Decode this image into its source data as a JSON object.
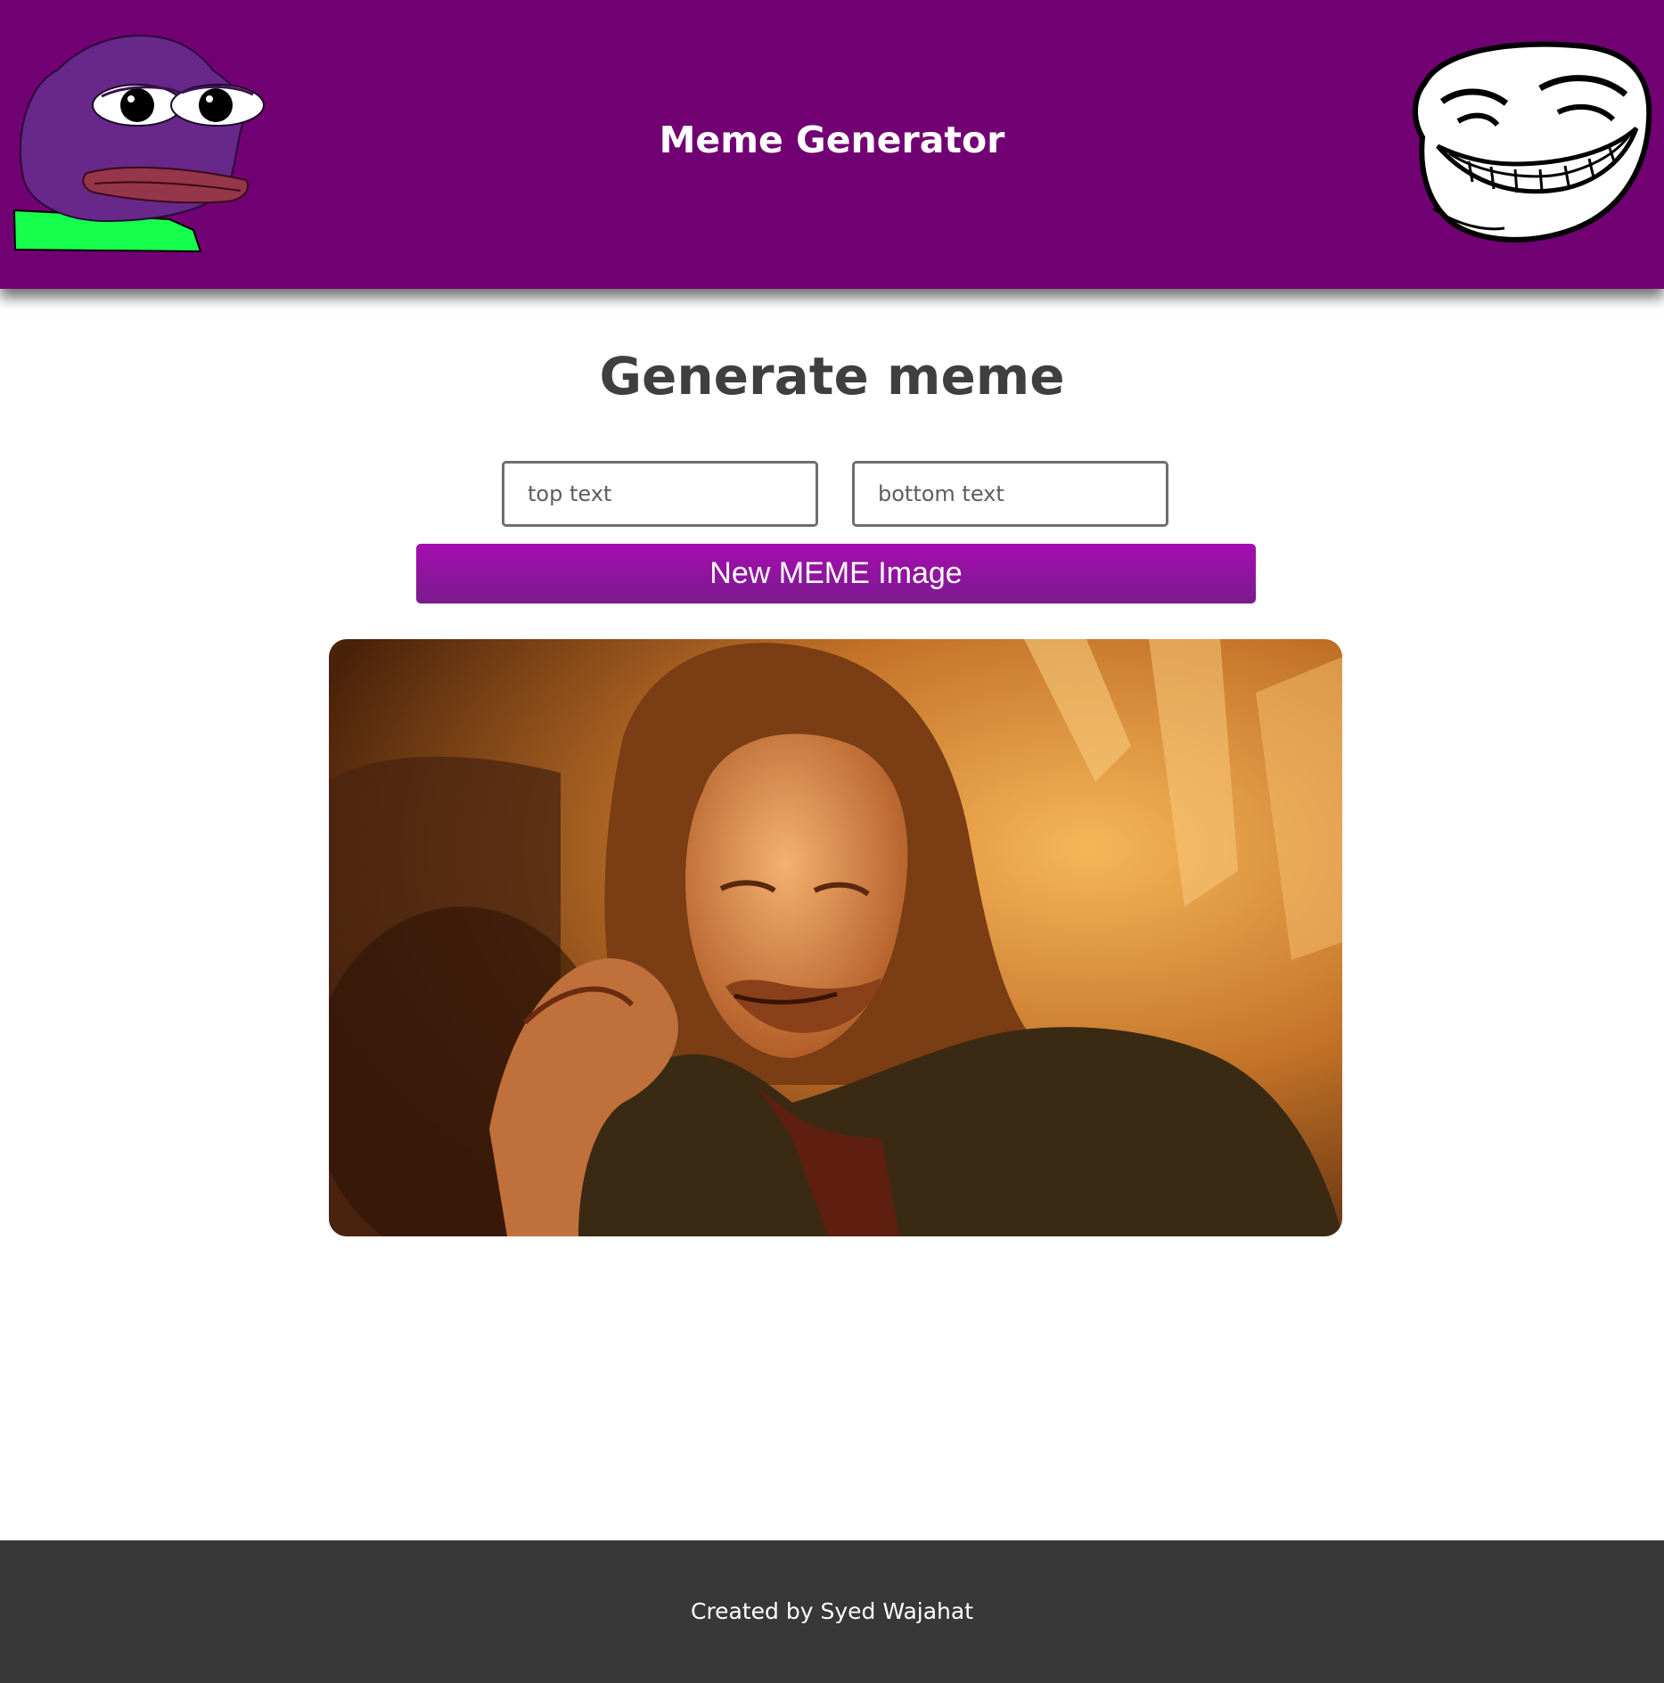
{
  "header": {
    "title": "Meme Generator",
    "left_logo": "pepe-frog-logo",
    "right_logo": "trollface-logo",
    "background_color": "#710072"
  },
  "main": {
    "heading": "Generate meme",
    "top_text": {
      "value": "",
      "placeholder": "top text"
    },
    "bottom_text": {
      "value": "",
      "placeholder": "bottom text"
    },
    "new_meme_button_label": "New MEME Image",
    "meme_image": "one-does-not-simply-meme-image"
  },
  "footer": {
    "text": "Created by Syed Wajahat",
    "background_color": "#383838"
  }
}
